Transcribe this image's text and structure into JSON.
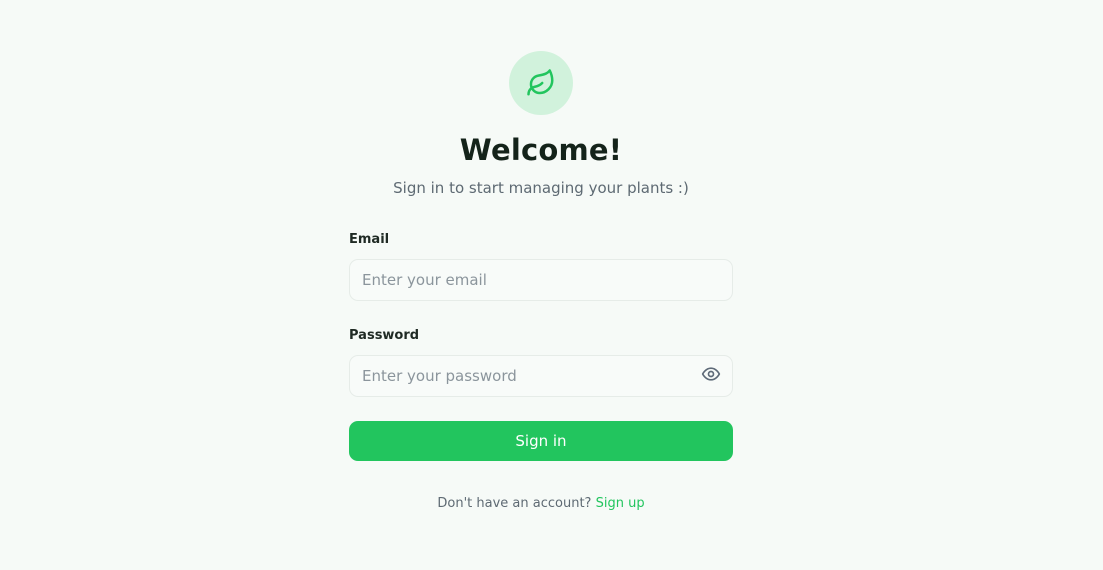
{
  "header": {
    "logo_icon": "leaf-icon",
    "title": "Welcome!",
    "subtitle": "Sign in to start managing your plants :)"
  },
  "form": {
    "email": {
      "label": "Email",
      "placeholder": "Enter your email",
      "value": ""
    },
    "password": {
      "label": "Password",
      "placeholder": "Enter your password",
      "value": "",
      "toggle_icon": "eye-icon"
    },
    "submit_label": "Sign in"
  },
  "footer": {
    "prompt": "Don't have an account?",
    "link_label": "Sign up"
  },
  "colors": {
    "background": "#f6faf7",
    "accent": "#22c55e",
    "logo_bg": "#d1f2dc",
    "title": "#14231a",
    "muted_text": "#5e6a73"
  }
}
